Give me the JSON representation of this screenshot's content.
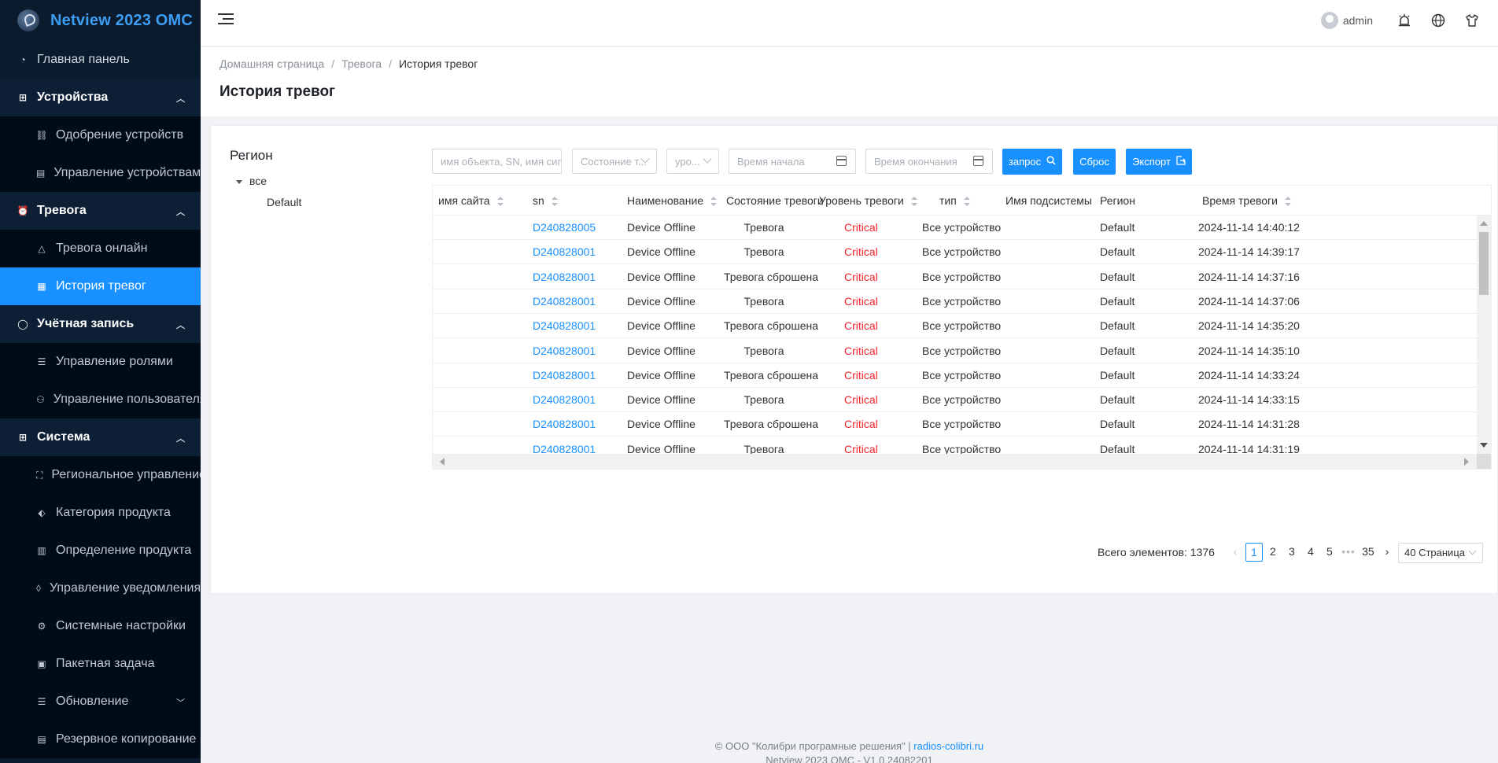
{
  "app": {
    "title": "Netview 2023 OMC"
  },
  "sidebar": {
    "items": [
      {
        "label": "Главная панель",
        "icon": "dashboard-icon",
        "kind": "plain"
      },
      {
        "label": "Устройства",
        "icon": "devices-icon",
        "kind": "top",
        "expanded": true
      },
      {
        "label": "Одобрение устройств",
        "icon": "link-icon",
        "kind": "sub"
      },
      {
        "label": "Управление устройствами",
        "icon": "device-list-icon",
        "kind": "sub"
      },
      {
        "label": "Тревога",
        "icon": "alarm-icon",
        "kind": "top",
        "expanded": true
      },
      {
        "label": "Тревога онлайн",
        "icon": "warning-icon",
        "kind": "sub"
      },
      {
        "label": "История тревог",
        "icon": "history-icon",
        "kind": "sub",
        "active": true
      },
      {
        "label": "Учётная запись",
        "icon": "user-icon",
        "kind": "top",
        "expanded": true
      },
      {
        "label": "Управление ролями",
        "icon": "list-icon",
        "kind": "sub"
      },
      {
        "label": "Управление пользователями",
        "icon": "users-icon",
        "kind": "sub"
      },
      {
        "label": "Система",
        "icon": "grid-icon",
        "kind": "top",
        "expanded": true
      },
      {
        "label": "Региональное управление",
        "icon": "hierarchy-icon",
        "kind": "sub"
      },
      {
        "label": "Категория продукта",
        "icon": "tag-icon",
        "kind": "sub"
      },
      {
        "label": "Определение продукта",
        "icon": "chart-icon",
        "kind": "sub"
      },
      {
        "label": "Управление уведомлениями",
        "icon": "bell-icon",
        "kind": "sub"
      },
      {
        "label": "Системные настройки",
        "icon": "gear-icon",
        "kind": "sub"
      },
      {
        "label": "Пакетная задача",
        "icon": "terminal-icon",
        "kind": "sub"
      },
      {
        "label": "Обновление",
        "icon": "list-icon",
        "kind": "sub",
        "collapsed_arrow": true
      },
      {
        "label": "Резервное копирование",
        "icon": "document-icon",
        "kind": "sub"
      }
    ]
  },
  "header": {
    "user": "admin"
  },
  "breadcrumb": {
    "home": "Домашняя страница",
    "section": "Тревога",
    "current": "История тревог"
  },
  "page": {
    "title": "История тревог"
  },
  "region": {
    "title": "Регион",
    "root": "все",
    "child": "Default"
  },
  "filters": {
    "search_placeholder": "имя объекта, SN, имя сигнал...",
    "status_placeholder": "Состояние т...",
    "level_placeholder": "уро...",
    "start_placeholder": "Время начала",
    "end_placeholder": "Время окончания",
    "query_label": "запрос",
    "reset_label": "Сброс",
    "export_label": "Экспорт"
  },
  "table": {
    "columns": [
      "имя сайта",
      "sn",
      "Наименование",
      "Состояние тревоги",
      "Уровень тревоги",
      "тип",
      "Имя подсистемы",
      "Регион",
      "Время тревоги"
    ],
    "rows": [
      [
        "",
        "D240828005",
        "Device Offline",
        "Тревога",
        "Critical",
        "Все устройство",
        "",
        "Default",
        "2024-11-14 14:40:12"
      ],
      [
        "",
        "D240828001",
        "Device Offline",
        "Тревога",
        "Critical",
        "Все устройство",
        "",
        "Default",
        "2024-11-14 14:39:17"
      ],
      [
        "",
        "D240828001",
        "Device Offline",
        "Тревога сброшена",
        "Critical",
        "Все устройство",
        "",
        "Default",
        "2024-11-14 14:37:16"
      ],
      [
        "",
        "D240828001",
        "Device Offline",
        "Тревога",
        "Critical",
        "Все устройство",
        "",
        "Default",
        "2024-11-14 14:37:06"
      ],
      [
        "",
        "D240828001",
        "Device Offline",
        "Тревога сброшена",
        "Critical",
        "Все устройство",
        "",
        "Default",
        "2024-11-14 14:35:20"
      ],
      [
        "",
        "D240828001",
        "Device Offline",
        "Тревога",
        "Critical",
        "Все устройство",
        "",
        "Default",
        "2024-11-14 14:35:10"
      ],
      [
        "",
        "D240828001",
        "Device Offline",
        "Тревога сброшена",
        "Critical",
        "Все устройство",
        "",
        "Default",
        "2024-11-14 14:33:24"
      ],
      [
        "",
        "D240828001",
        "Device Offline",
        "Тревога",
        "Critical",
        "Все устройство",
        "",
        "Default",
        "2024-11-14 14:33:15"
      ],
      [
        "",
        "D240828001",
        "Device Offline",
        "Тревога сброшена",
        "Critical",
        "Все устройство",
        "",
        "Default",
        "2024-11-14 14:31:28"
      ],
      [
        "",
        "D240828001",
        "Device Offline",
        "Тревога",
        "Critical",
        "Все устройство",
        "",
        "Default",
        "2024-11-14 14:31:19"
      ]
    ]
  },
  "pagination": {
    "total_text": "Всего элементов: 1376",
    "pages": [
      "1",
      "2",
      "3",
      "4",
      "5"
    ],
    "dots": "•••",
    "last": "35",
    "page_size": "40 Страница",
    "current": 1
  },
  "footer": {
    "copyright": "© ООО \"Колибри програмные решения\" | ",
    "link": "radios-colibri.ru",
    "version": "Netview 2023 OMC - V1.0.24082201"
  },
  "colors": {
    "accent": "#1890ff",
    "sidebar": "#0a1b2e",
    "critical": "#f5222d"
  }
}
